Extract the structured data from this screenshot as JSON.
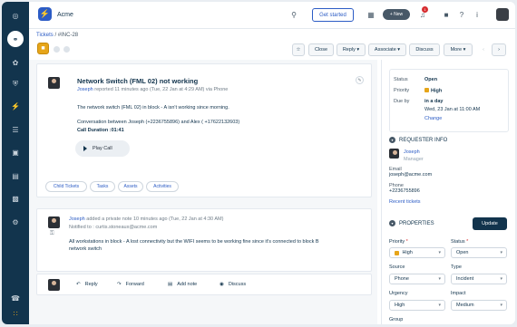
{
  "app": {
    "title": "Acme"
  },
  "header": {
    "get_started": "Get started",
    "new_label": "+ New",
    "notif_count": "1"
  },
  "breadcrumb": {
    "link": "Tickets",
    "sep": " / ",
    "id": "#INC-28"
  },
  "toolbar": {
    "close": "Close",
    "reply": "Reply ▾",
    "associate": "Associate ▾",
    "discuss": "Discuss",
    "more": "More ▾"
  },
  "ticket": {
    "title": "Network Switch (FML 02) not working",
    "reporter": "Joseph",
    "reported_meta": "reported 11 minutes ago (Tue, 22 Jan at 4:29 AM) via Phone",
    "description": "The network switch (FML 02) in block - A isn't working since morning.",
    "conversation": "Conversation between Joseph (+2236755896) and Alex ( +17622132603)",
    "call_duration": "Call Duration :01:41",
    "play_call": "Play Call"
  },
  "tabs": [
    "Child Tickets",
    "Tasks",
    "Assets",
    "Activities"
  ],
  "note": {
    "author": "Joseph",
    "meta": "added a private note 10 minutes ago (Tue, 22 Jan at 4:30 AM)",
    "notified": "Notified to : curtis.stoneaux@acme.com",
    "body_1": "All workstations in block - A lost connectivity but the WIFI seems to be working fine since it's connected to block B",
    "body_2": "network switch"
  },
  "actions": {
    "reply": "Reply",
    "forward": "Forward",
    "add_note": "Add note",
    "discuss": "Discuss"
  },
  "status_box": {
    "status_label": "Status",
    "status_value": "Open",
    "priority_label": "Priority",
    "priority_value": "High",
    "due_label": "Due by",
    "due_value": "in a day",
    "due_date": "Wed, 23 Jan at 11:00 AM",
    "change": "Change"
  },
  "requester": {
    "heading": "REQUESTER INFO",
    "name": "Joseph",
    "role": "Manager",
    "email_label": "Email",
    "email": "joseph@acme.com",
    "phone_label": "Phone",
    "phone": "+2236755896",
    "recent": "Recent tickets"
  },
  "properties": {
    "heading": "PROPERTIES",
    "update": "Update",
    "priority_label": "Priority",
    "priority_value": "High",
    "status_label": "Status",
    "status_value": "Open",
    "source_label": "Source",
    "source_value": "Phone",
    "type_label": "Type",
    "type_value": "Incident",
    "urgency_label": "Urgency",
    "urgency_value": "High",
    "impact_label": "Impact",
    "impact_value": "Medium",
    "group_label": "Group"
  },
  "colors": {
    "nav": "#12344d",
    "accent": "#2c5cc5",
    "priority_high": "#e6a519"
  }
}
